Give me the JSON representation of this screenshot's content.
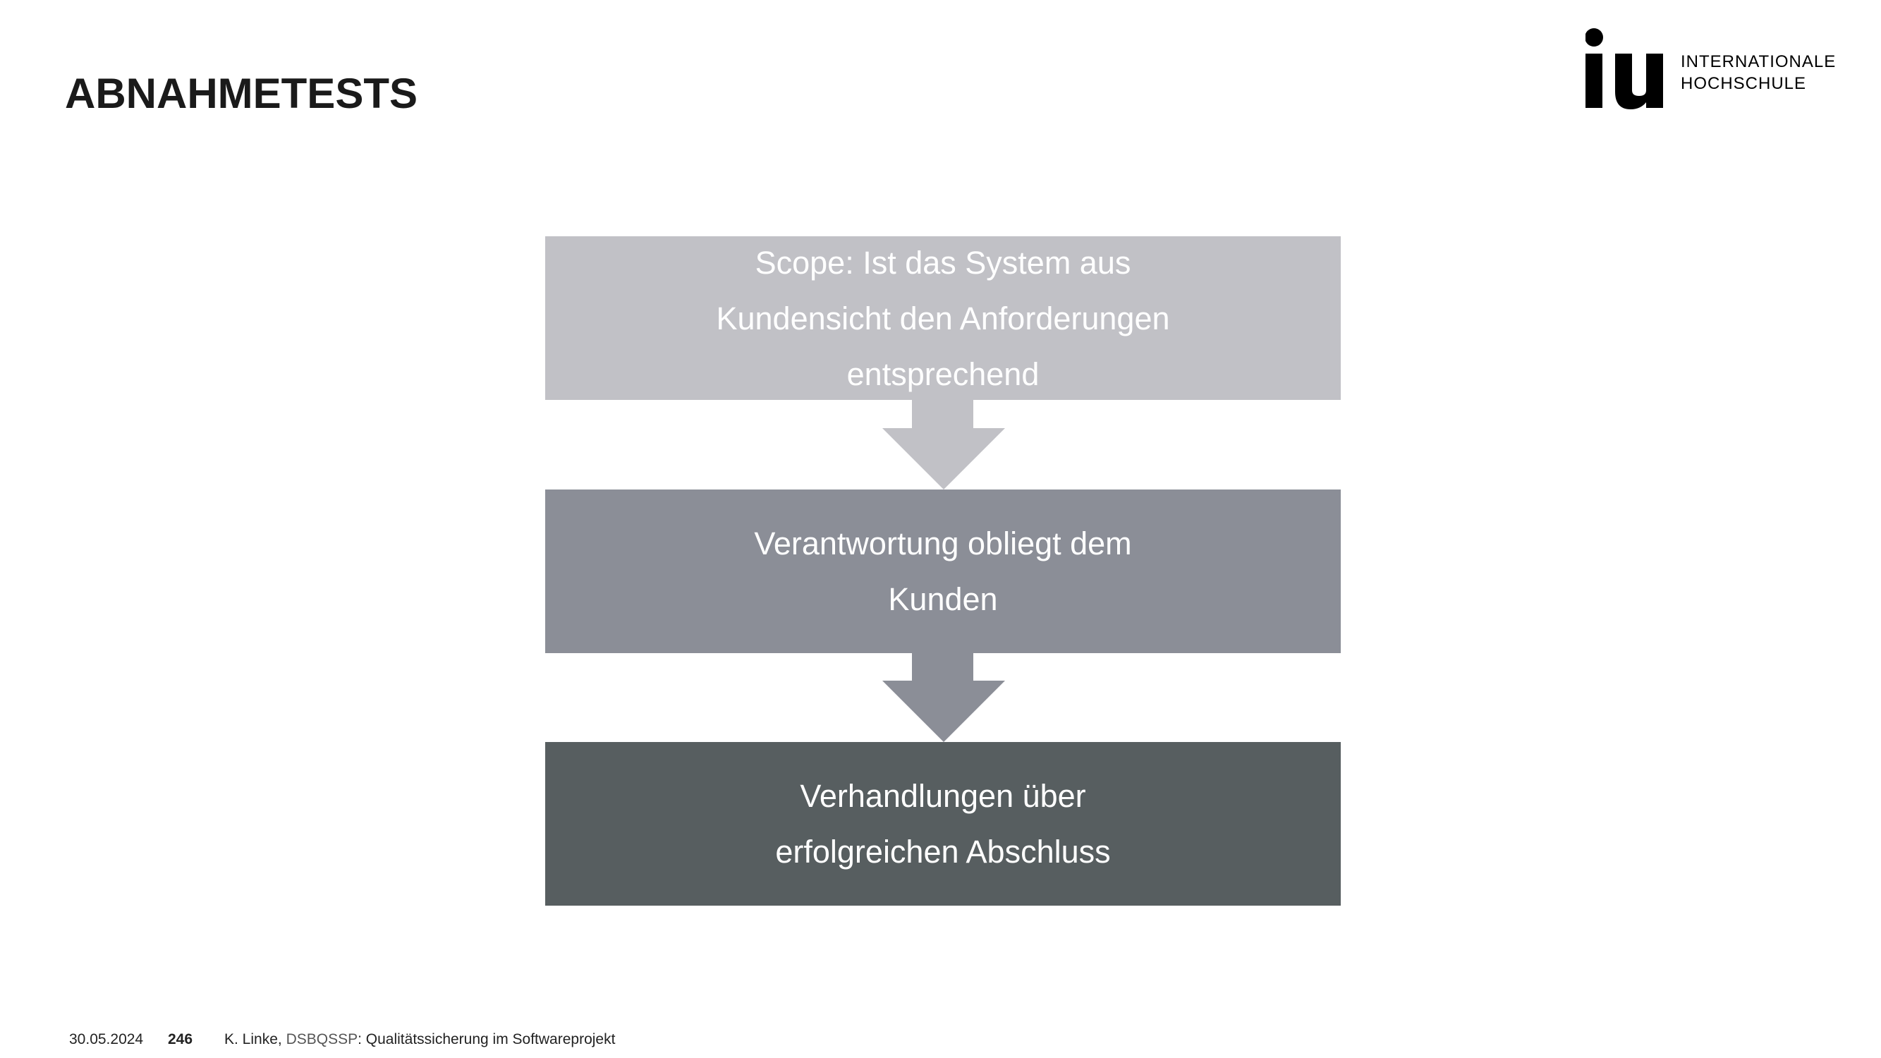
{
  "header": {
    "title": "ABNAHMETESTS"
  },
  "logo": {
    "mark": "iu",
    "line1": "INTERNATIONALE",
    "line2": "HOCHSCHULE"
  },
  "flow": {
    "steps": [
      {
        "text": "Scope: Ist das System aus\nKundensicht den Anforderungen\nentsprechend",
        "color": "#c1c1c6"
      },
      {
        "text": "Verantwortung obliegt dem\nKunden",
        "color": "#8b8e97"
      },
      {
        "text": "Verhandlungen über\nerfolgreichen Abschluss",
        "color": "#575e60"
      }
    ]
  },
  "footer": {
    "date": "30.05.2024",
    "page": "246",
    "author": "K. Linke, ",
    "course_code": "DSBQSSP",
    "course_title": ": Qualitätssicherung im Softwareprojekt"
  }
}
